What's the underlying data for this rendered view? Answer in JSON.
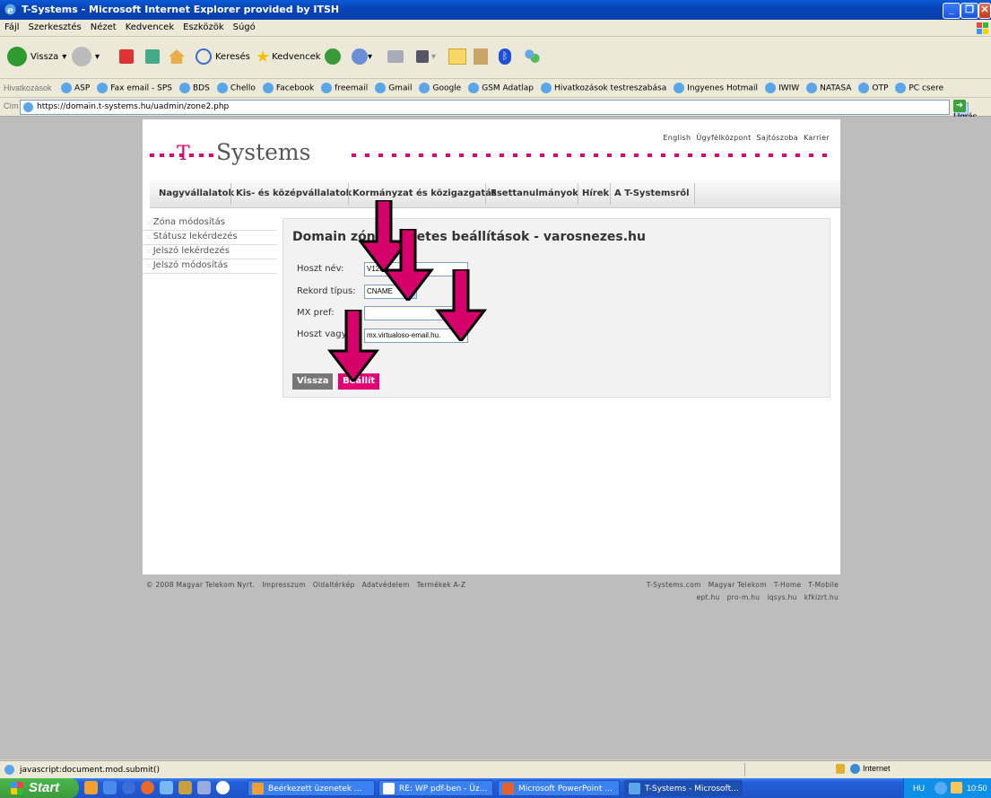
{
  "window": {
    "title": "T-Systems - Microsoft Internet Explorer provided by ITSH"
  },
  "menu": [
    "Fájl",
    "Szerkesztés",
    "Nézet",
    "Kedvencek",
    "Eszközök",
    "Súgó"
  ],
  "toolbar": {
    "back_label": "Vissza",
    "search_label": "Keresés",
    "favorites_label": "Kedvencek"
  },
  "links": {
    "label": "Hivatkozások",
    "items": [
      "ASP",
      "Fax email - SPS",
      "BDS",
      "Chello",
      "Facebook",
      "freemail",
      "Gmail",
      "Google",
      "GSM Adatlap",
      "Hivatkozások testreszabása",
      "Ingyenes Hotmail",
      "IWIW",
      "NATASA",
      "OTP",
      "PC csere"
    ]
  },
  "address": {
    "label": "Cím",
    "url": "https://domain.t-systems.hu/uadmin/zone2.php",
    "go_label": "Ugrás"
  },
  "site": {
    "brand": "Systems",
    "top_links": [
      "English",
      "Ügyfélközpont",
      "Sajtószoba",
      "Karrier"
    ],
    "nav": [
      "Nagyvállalatok",
      "Kis- és középvállalatok",
      "Kormányzat és közigazgatás",
      "Esettanulmányok",
      "Hírek",
      "A T-Systemsről"
    ],
    "side_nav": [
      "Zóna módosítás",
      "Státusz lekérdezés",
      "Jelszó lekérdezés",
      "Jelszó módosítás"
    ],
    "heading_left": "Domain zón",
    "heading_right": "etes beállítások - varosnezes.hu",
    "form": {
      "host_label": "Hoszt név:",
      "host_value": "V1234",
      "record_label": "Rekord típus:",
      "record_value": "CNAME",
      "mx_label": "MX pref:",
      "mx_value": "",
      "target_label": "Hoszt vagy",
      "target_value": "mx.virtualoso-email.hu."
    },
    "back_button": "Vissza",
    "set_button": "Beállít",
    "footer_left": [
      "© 2008 Magyar Telekom Nyrt.",
      "Impresszum",
      "Oldaltérkép",
      "Adatvédelem",
      "Termékek A-Z"
    ],
    "footer_right1": [
      "T-Systems.com",
      "Magyar Telekom",
      "T-Home",
      "T-Mobile"
    ],
    "footer_right2": [
      "ept.hu",
      "pro-m.hu",
      "iqsys.hu",
      "kfkizrt.hu"
    ]
  },
  "status": {
    "text": "javascript:document.mod.submit()",
    "zone": "Internet"
  },
  "taskbar": {
    "start": "Start",
    "tasks": [
      "Beérkezett üzenetek ...",
      "RE: WP pdf-ben - Üz...",
      "Microsoft PowerPoint ...",
      "T-Systems - Microsoft..."
    ],
    "lang": "HU",
    "clock": "10:50"
  },
  "colors": {
    "magenta": "#e20074",
    "xp_blue": "#245edb"
  }
}
